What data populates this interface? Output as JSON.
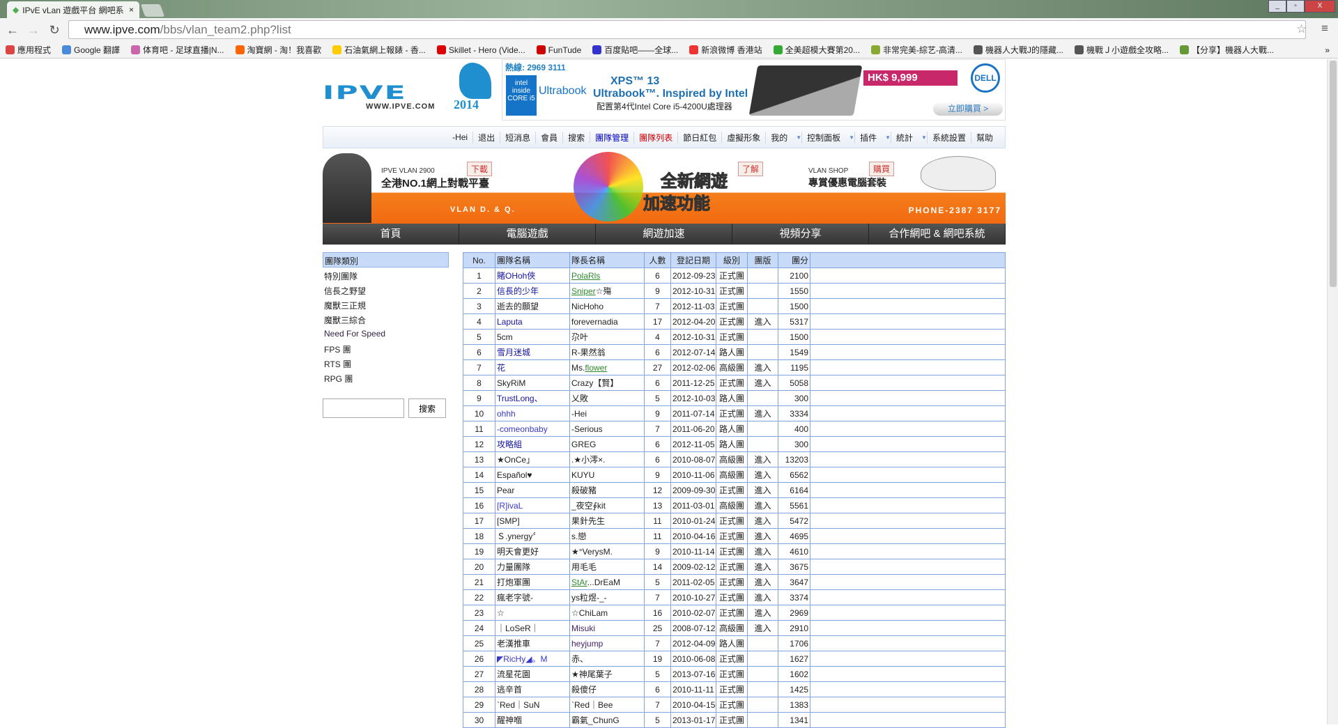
{
  "browser": {
    "tab_title": "IPvE vLan 遊戲平台 網吧系",
    "url_host": "www.ipve.com",
    "url_path": "/bbs/vlan_team2.php?list",
    "bookmarks": [
      {
        "label": "應用程式",
        "color": "#d44"
      },
      {
        "label": "Google 翻譯",
        "color": "#4a8ad8"
      },
      {
        "label": "体育吧 - 足球直播|N...",
        "color": "#c6a"
      },
      {
        "label": "淘寶網 - 淘！我喜歡",
        "color": "#f60"
      },
      {
        "label": "石油氣網上報錶 - 香...",
        "color": "#fc0"
      },
      {
        "label": "Skillet - Hero (Vide...",
        "color": "#d00"
      },
      {
        "label": "FunTude",
        "color": "#c00"
      },
      {
        "label": "百度貼吧——全球...",
        "color": "#33c"
      },
      {
        "label": "新浪微博 香港站",
        "color": "#e33"
      },
      {
        "label": "全美超模大賽第20...",
        "color": "#3a3"
      },
      {
        "label": "非常完美-綜艺-高清...",
        "color": "#8a3"
      },
      {
        "label": "機器人大戰J的隱藏...",
        "color": "#555"
      },
      {
        "label": "機戰Ｊ小遊戲全攻略...",
        "color": "#555"
      },
      {
        "label": "【分享】機器人大戰...",
        "color": "#693"
      }
    ],
    "more": "»"
  },
  "logo": {
    "text": "IPVE",
    "url": "WWW.IPVE.COM",
    "year": "2014"
  },
  "ad": {
    "hotline": "熱線: 2969 3111",
    "intel": "intel inside CORE i5",
    "ultrabook": "Ultrabook",
    "xps": "XPS™ 13",
    "tagline": "Ultrabook™. Inspired by Intel",
    "config": "配置第4代Intel Core i5-4200U處理器",
    "price": "HK$ 9,999",
    "brand": "DELL",
    "buy": "立即購買 >"
  },
  "usernav": [
    {
      "label": "-Hei"
    },
    {
      "label": "退出"
    },
    {
      "label": "短消息"
    },
    {
      "label": "會員"
    },
    {
      "label": "搜索"
    },
    {
      "label": "團隊管理",
      "style": "blue"
    },
    {
      "label": "團隊列表",
      "style": "red"
    },
    {
      "label": "節日紅包"
    },
    {
      "label": "虛擬形象"
    },
    {
      "label": "我的",
      "dd": true
    },
    {
      "label": "控制面板",
      "dd": true
    },
    {
      "label": "插件",
      "dd": true
    },
    {
      "label": "統計",
      "dd": true
    },
    {
      "label": "系統設置"
    },
    {
      "label": "幫助"
    }
  ],
  "banner": {
    "ipve": "IPVE VLAN 2900",
    "slogan": "全港NO.1網上對戰平臺",
    "download": "下載",
    "vlan": "VLAN D. & Q.",
    "new1": "全新網遊",
    "new2": "加速功能",
    "learn": "了解",
    "shop": "VLAN SHOP",
    "shop_slogan": "專賞優惠電腦套裝",
    "buy": "購買",
    "phone": "PHONE-2387 3177"
  },
  "mainnav": [
    "首頁",
    "電腦遊戲",
    "網遊加速",
    "視頻分享",
    "合作網吧 & 網吧系統"
  ],
  "sidebar": {
    "header": "團隊類別",
    "items": [
      "特別團隊",
      "信長之野望",
      "魔獸三正規",
      "魔獸三綜合",
      "Need For Speed",
      "FPS 團",
      "RTS 團",
      "RPG 團"
    ],
    "search_button": "搜索",
    "search_value": ""
  },
  "table": {
    "headers": [
      "No.",
      "團隊名稱",
      "隊長名稱",
      "人數",
      "登記日期",
      "級別",
      "團版",
      "團分"
    ],
    "rows": [
      {
        "no": "1",
        "team": "賭OHoh俠",
        "ts": "link",
        "leader": [
          "",
          "PolaRls",
          ""
        ],
        "cnt": "6",
        "date": "2012-09-23",
        "lvl": "正式團",
        "brd": "",
        "score": "2100"
      },
      {
        "no": "2",
        "team": "信長的少年",
        "ts": "link",
        "leader": [
          "",
          "Sniper",
          "☆殤"
        ],
        "cnt": "9",
        "date": "2012-10-31",
        "lvl": "正式團",
        "brd": "",
        "score": "1550"
      },
      {
        "no": "3",
        "team": "逝去的願望",
        "ts": "",
        "leader": [
          "NicHoho",
          "",
          ""
        ],
        "cnt": "7",
        "date": "2012-11-03",
        "lvl": "正式團",
        "brd": "",
        "score": "1500"
      },
      {
        "no": "4",
        "team": "Laputa",
        "ts": "link",
        "leader": [
          "forevernadia",
          "",
          ""
        ],
        "cnt": "17",
        "date": "2012-04-20",
        "lvl": "正式團",
        "brd": "進入",
        "score": "5317"
      },
      {
        "no": "5",
        "team": "5cm",
        "ts": "",
        "leader": [
          "尕叶",
          "",
          ""
        ],
        "cnt": "4",
        "date": "2012-10-31",
        "lvl": "正式團",
        "brd": "",
        "score": "1500"
      },
      {
        "no": "6",
        "team": "雪月迷城",
        "ts": "link",
        "leader": [
          "R-果然翁",
          "",
          ""
        ],
        "cnt": "6",
        "date": "2012-07-14",
        "lvl": "路人團",
        "brd": "",
        "score": "1549"
      },
      {
        "no": "7",
        "team": "花",
        "ts": "link",
        "leader": [
          "Ms.",
          "flower",
          ""
        ],
        "cnt": "27",
        "date": "2012-02-06",
        "lvl": "高級團",
        "brd": "進入",
        "score": "1195"
      },
      {
        "no": "8",
        "team": "SkyRiM",
        "ts": "",
        "leader": [
          "Crazy【賢】",
          "",
          ""
        ],
        "cnt": "6",
        "date": "2011-12-25",
        "lvl": "正式團",
        "brd": "進入",
        "score": "5058"
      },
      {
        "no": "9",
        "team": "TrustLong、",
        "ts": "link",
        "leader": [
          "乂敗",
          "",
          ""
        ],
        "cnt": "5",
        "date": "2012-10-03",
        "lvl": "路人團",
        "brd": "",
        "score": "300"
      },
      {
        "no": "10",
        "team": "ohhh",
        "ts": "link2",
        "leader": [
          "-Hei",
          "",
          ""
        ],
        "cnt": "9",
        "date": "2011-07-14",
        "lvl": "正式團",
        "brd": "進入",
        "score": "3334"
      },
      {
        "no": "11",
        "team": "-comeonbaby",
        "ts": "link2",
        "leader": [
          "-Serious",
          "",
          ""
        ],
        "cnt": "7",
        "date": "2011-06-20",
        "lvl": "路人團",
        "brd": "",
        "score": "400"
      },
      {
        "no": "12",
        "team": "攻略組",
        "ts": "link",
        "leader": [
          "GREG",
          "",
          ""
        ],
        "cnt": "6",
        "date": "2012-11-05",
        "lvl": "路人團",
        "brd": "",
        "score": "300"
      },
      {
        "no": "13",
        "team": "★OnCe」",
        "ts": "",
        "leader": [
          ".★小澪×.",
          "",
          ""
        ],
        "cnt": "6",
        "date": "2010-08-07",
        "lvl": "高級團",
        "brd": "進入",
        "score": "13203"
      },
      {
        "no": "14",
        "team": "Español♥",
        "ts": "",
        "leader": [
          "KUYU",
          "",
          ""
        ],
        "cnt": "9",
        "date": "2010-11-06",
        "lvl": "高級團",
        "brd": "進入",
        "score": "6562"
      },
      {
        "no": "15",
        "team": "Pear",
        "ts": "",
        "leader": [
          "殺破豬",
          "",
          ""
        ],
        "cnt": "12",
        "date": "2009-09-30",
        "lvl": "正式團",
        "brd": "進入",
        "score": "6164"
      },
      {
        "no": "16",
        "team": "[R]ivaL",
        "ts": "link2",
        "leader": [
          "_夜空∮kit",
          "",
          ""
        ],
        "cnt": "13",
        "date": "2011-03-01",
        "lvl": "高級團",
        "brd": "進入",
        "score": "5561"
      },
      {
        "no": "17",
        "team": "[SMP]",
        "ts": "",
        "leader": [
          "果針先生",
          "",
          ""
        ],
        "cnt": "11",
        "date": "2010-01-24",
        "lvl": "正式團",
        "brd": "進入",
        "score": "5472"
      },
      {
        "no": "18",
        "team": "Ｓ.ynergy〞",
        "ts": "",
        "leader": [
          "s.戀",
          "",
          ""
        ],
        "cnt": "11",
        "date": "2010-04-16",
        "lvl": "正式團",
        "brd": "進入",
        "score": "4695"
      },
      {
        "no": "19",
        "team": "明天會更好",
        "ts": "",
        "leader": [
          "★°VerysM.",
          "",
          ""
        ],
        "cnt": "9",
        "date": "2010-11-14",
        "lvl": "正式團",
        "brd": "進入",
        "score": "4610"
      },
      {
        "no": "20",
        "team": "力量團隊",
        "ts": "",
        "leader": [
          "用毛毛",
          "",
          ""
        ],
        "cnt": "14",
        "date": "2009-02-12",
        "lvl": "正式團",
        "brd": "進入",
        "score": "3675"
      },
      {
        "no": "21",
        "team": "打炮軍團",
        "ts": "",
        "leader": [
          "",
          "StAr",
          "...DrEaM"
        ],
        "cnt": "5",
        "date": "2011-02-05",
        "lvl": "正式團",
        "brd": "進入",
        "score": "3647"
      },
      {
        "no": "22",
        "team": "瘋老字號-",
        "ts": "",
        "leader": [
          "ys粒煜-_-",
          "",
          ""
        ],
        "cnt": "7",
        "date": "2010-10-27",
        "lvl": "正式團",
        "brd": "進入",
        "score": "3374"
      },
      {
        "no": "23",
        "team": "☆",
        "ts": "",
        "leader": [
          "☆ChiLam",
          "",
          ""
        ],
        "cnt": "16",
        "date": "2010-02-07",
        "lvl": "正式團",
        "brd": "進入",
        "score": "2969"
      },
      {
        "no": "24",
        "team": "｜LoSeR｜",
        "ts": "",
        "leader": [
          "Misuki",
          "",
          ""
        ],
        "ls": "purple",
        "cnt": "25",
        "date": "2008-07-12",
        "lvl": "高級團",
        "brd": "進入",
        "score": "2910"
      },
      {
        "no": "25",
        "team": "老漢推車",
        "ts": "",
        "leader": [
          "heyjump",
          "",
          ""
        ],
        "ls": "purple",
        "cnt": "7",
        "date": "2012-04-09",
        "lvl": "路人團",
        "brd": "",
        "score": "1706"
      },
      {
        "no": "26",
        "team": "◤RicHy◢。M",
        "ts": "link2",
        "leader": [
          "赤、",
          "",
          ""
        ],
        "cnt": "19",
        "date": "2010-06-08",
        "lvl": "正式團",
        "brd": "",
        "score": "1627"
      },
      {
        "no": "27",
        "team": "流星花園",
        "ts": "",
        "leader": [
          "★神尾葉子",
          "",
          ""
        ],
        "cnt": "5",
        "date": "2013-07-16",
        "lvl": "正式團",
        "brd": "",
        "score": "1602"
      },
      {
        "no": "28",
        "team": "逃辛首",
        "ts": "",
        "leader": [
          "殺傻仔",
          "",
          ""
        ],
        "cnt": "6",
        "date": "2010-11-11",
        "lvl": "正式團",
        "brd": "",
        "score": "1425"
      },
      {
        "no": "29",
        "team": "ˋRed｜SuN",
        "ts": "",
        "leader": [
          "ˋRed｜Bee",
          "",
          ""
        ],
        "cnt": "7",
        "date": "2010-04-15",
        "lvl": "正式團",
        "brd": "",
        "score": "1383"
      },
      {
        "no": "30",
        "team": "醒神嗰",
        "ts": "",
        "leader": [
          "霸氣_ChunG",
          "",
          ""
        ],
        "cnt": "5",
        "date": "2013-01-17",
        "lvl": "正式團",
        "brd": "",
        "score": "1341"
      }
    ]
  }
}
